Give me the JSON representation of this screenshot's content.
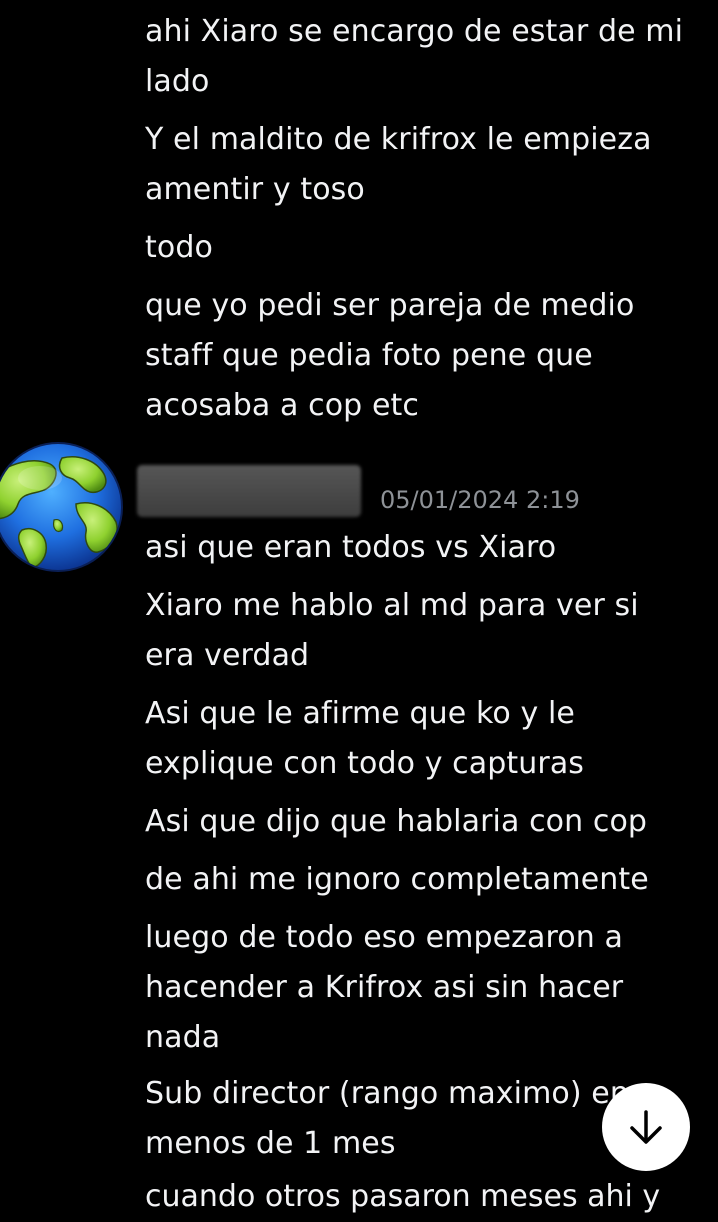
{
  "colors": {
    "background": "#000000",
    "message_text": "#f2f3f5",
    "timestamp": "#8e9297",
    "scroll_button_bg": "#ffffff",
    "scroll_button_icon": "#000000"
  },
  "messages_before": [
    "ahi Xiaro se encargo de estar de mi lado",
    "Y el maldito de krifrox le empieza amentir y toso",
    "todo",
    "que yo pedi ser pareja de medio staff que pedia foto pene que acosaba a cop etc"
  ],
  "message_group": {
    "avatar_icon": "globe-earth-icon",
    "username": "",
    "timestamp": "05/01/2024 2:19"
  },
  "messages_after": [
    "asi que eran todos vs Xiaro",
    "Xiaro me hablo al md para ver si era verdad",
    "Asi que le afirme que ko y le explique con todo y capturas",
    "Asi que dijo que hablaria con cop",
    "de ahi me ignoro completamente",
    "luego de todo eso empezaron a hacender a Krifrox asi sin hacer nada",
    "Sub director (rango maximo) en menos de 1 mes",
    "cuando otros pasaron meses ahi y"
  ],
  "scroll_button": {
    "icon": "arrow-down-icon"
  }
}
